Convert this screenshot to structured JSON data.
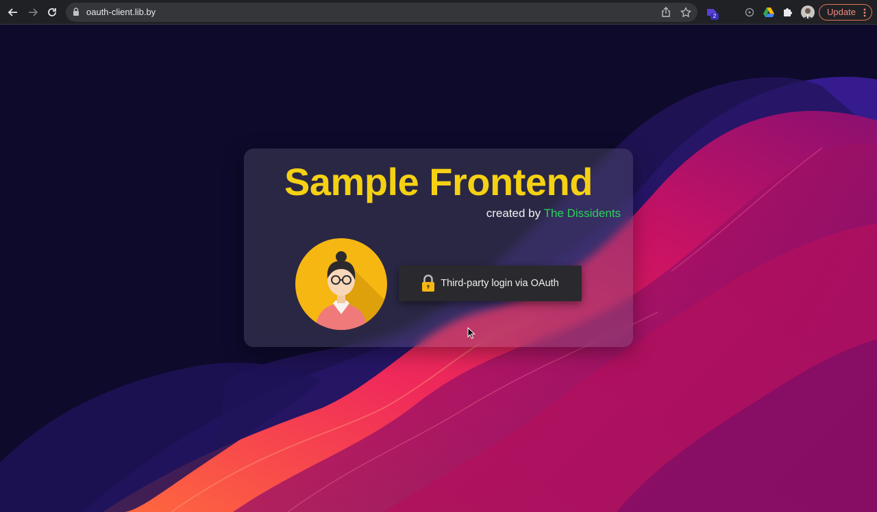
{
  "browser": {
    "url": "oauth-client.lib.by",
    "extension_badge": "2",
    "update_label": "Update",
    "icons": [
      "back-icon",
      "forward-icon",
      "reload-icon",
      "lock-icon",
      "share-icon",
      "star-icon",
      "extension-icon",
      "circle-icon",
      "google-drive-icon",
      "puzzle-icon",
      "profile-avatar",
      "more-vert-icon"
    ]
  },
  "card": {
    "title": "Sample Frontend",
    "created_by_prefix": "created by",
    "team_name": "The Dissidents",
    "login_label": "Third-party login via OAuth"
  },
  "colors": {
    "title": "#f5d113",
    "team": "#2bd35a",
    "background": "#0d0a2b",
    "accent_pink": "#e0135e",
    "update_outline": "#e2725b"
  }
}
